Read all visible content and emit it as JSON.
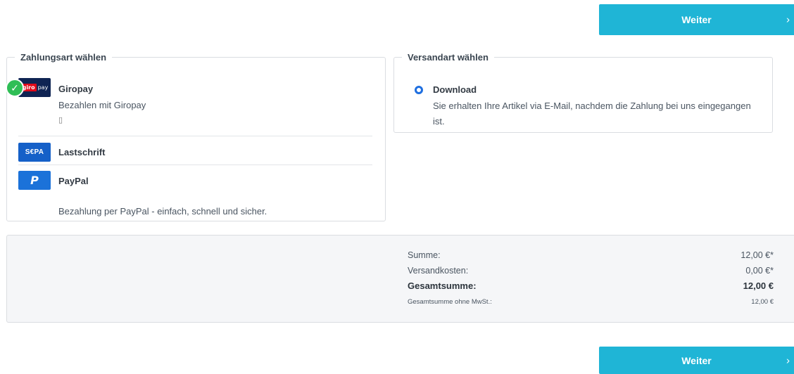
{
  "buttons": {
    "continue_label": "Weiter",
    "chevron": "›"
  },
  "payment": {
    "legend": "Zahlungsart wählen",
    "methods": [
      {
        "name": "Giropay",
        "description": "Bezahlen mit Giropay",
        "extra": "▯",
        "logo_text_1": "giro",
        "logo_text_2": "pay",
        "selected": true
      },
      {
        "name": "Lastschrift",
        "logo_text": "S€PA"
      },
      {
        "name": "PayPal",
        "description": "Bezahlung per PayPal - einfach, schnell und sicher.",
        "logo_text": "P"
      }
    ],
    "check_glyph": "✓"
  },
  "shipping": {
    "legend": "Versandart wählen",
    "method_name": "Download",
    "method_desc_1": "Sie erhalten Ihre Artikel via E-Mail, nachdem die Zahlung bei uns eingegangen",
    "method_desc_2": "ist."
  },
  "summary": {
    "subtotal_label": "Summe:",
    "subtotal_value": "12,00 €*",
    "shipping_label": "Versandkosten:",
    "shipping_value": "0,00 €*",
    "total_label": "Gesamtsumme:",
    "total_value": "12,00 €",
    "net_label": "Gesamtsumme ohne MwSt.:",
    "net_value": "12,00 €"
  },
  "colors": {
    "accent": "#1fb5d6",
    "selected": "#2fbe56",
    "radio": "#1f6fe0"
  }
}
